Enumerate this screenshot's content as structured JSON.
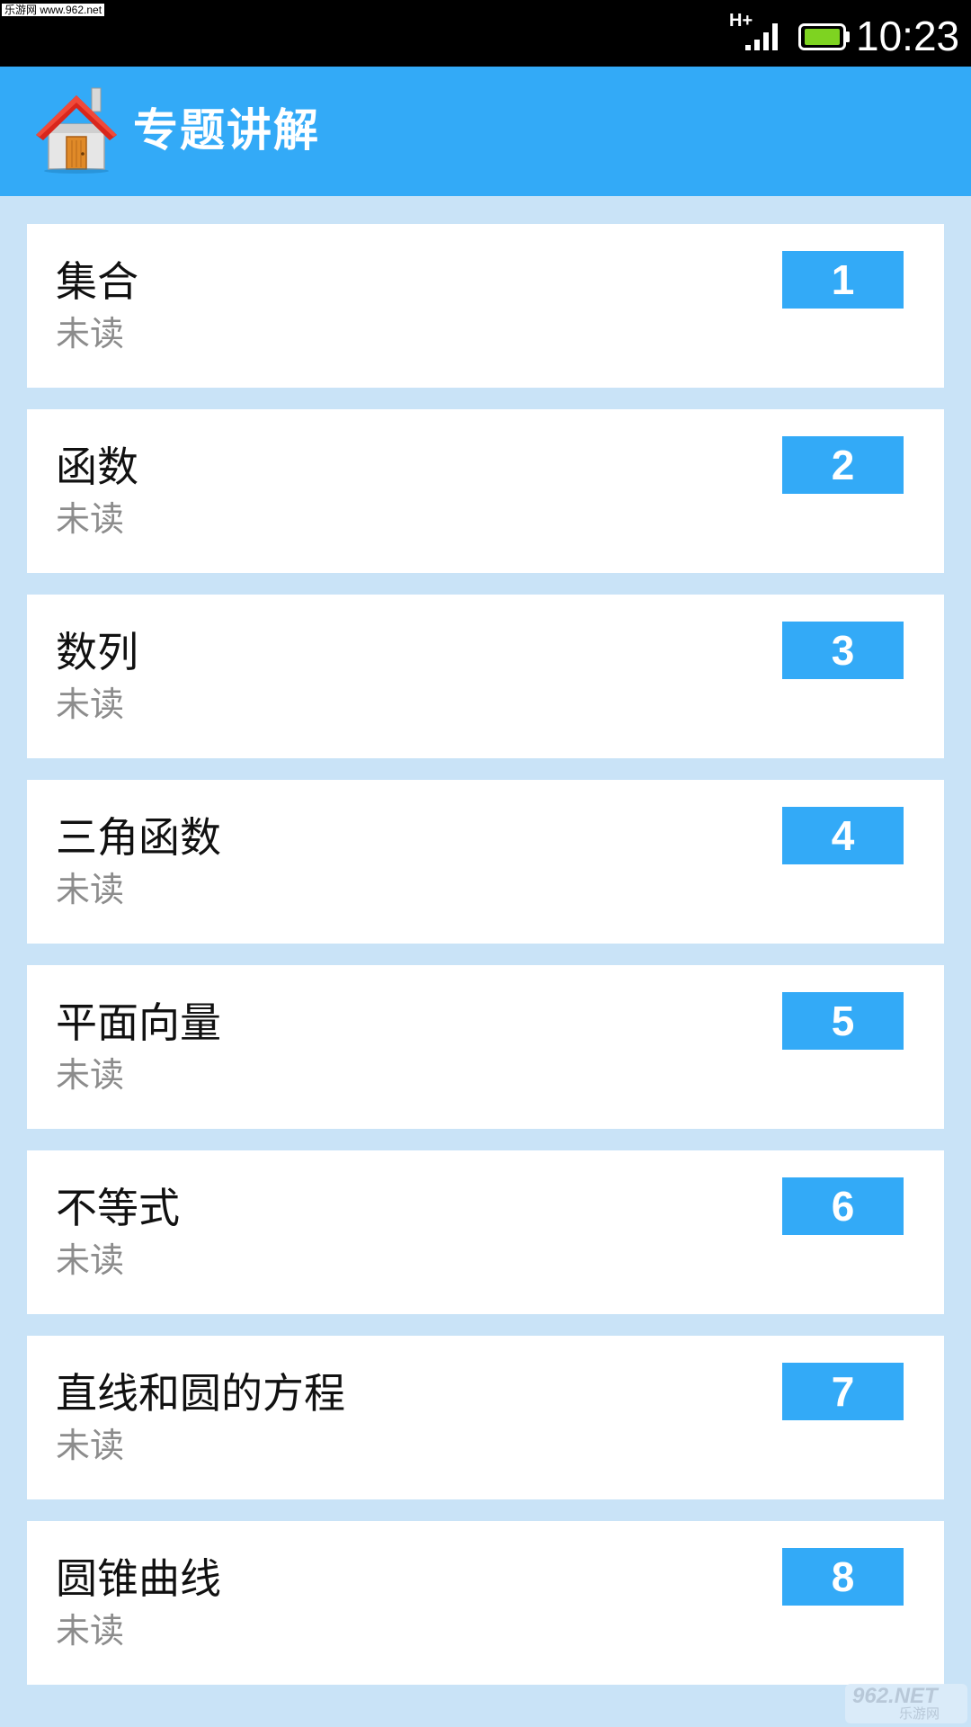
{
  "status_bar": {
    "watermark": "乐游网 www.962.net",
    "network": "H+",
    "time": "10:23",
    "signal_icon": "cell-signal-icon",
    "battery_icon": "battery-icon",
    "battery_color": "#7ed321"
  },
  "app_bar": {
    "title": "专题讲解",
    "icon": "home-icon",
    "background": "#33aaf7"
  },
  "topics": [
    {
      "title": "集合",
      "status": "未读",
      "number": "1"
    },
    {
      "title": "函数",
      "status": "未读",
      "number": "2"
    },
    {
      "title": "数列",
      "status": "未读",
      "number": "3"
    },
    {
      "title": "三角函数",
      "status": "未读",
      "number": "4"
    },
    {
      "title": "平面向量",
      "status": "未读",
      "number": "5"
    },
    {
      "title": "不等式",
      "status": "未读",
      "number": "6"
    },
    {
      "title": "直线和圆的方程",
      "status": "未读",
      "number": "7"
    },
    {
      "title": "圆锥曲线",
      "status": "未读",
      "number": "8"
    }
  ],
  "watermark_logo": {
    "main": "962.NET",
    "sub": "乐游网"
  }
}
